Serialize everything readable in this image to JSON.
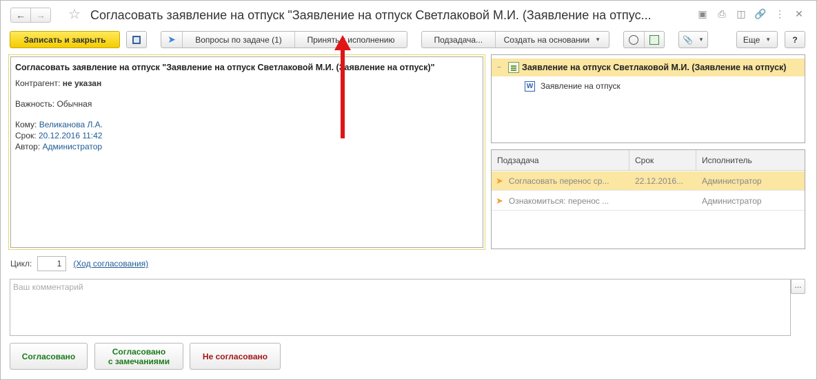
{
  "window": {
    "title": "Согласовать заявление на отпуск \"Заявление на отпуск Светлаковой М.И. (Заявление на отпус..."
  },
  "titlebar": {
    "icons": [
      "back-arrow",
      "forward-arrow",
      "star",
      "save-disk",
      "print",
      "preview",
      "link",
      "more-vertical",
      "close"
    ]
  },
  "toolbar": {
    "save_close_label": "Записать и закрыть",
    "questions_label": "Вопросы по задаче (1)",
    "accept_label": "Принять к исполнению",
    "subtask_label": "Подзадача...",
    "create_based_label": "Создать на основании",
    "more_label": "Еще",
    "help_label": "?"
  },
  "task": {
    "title": "Согласовать заявление на отпуск \"Заявление на отпуск Светлаковой М.И. (Заявление на отпуск)\"",
    "counterparty_label": "Контрагент:",
    "counterparty_value": "не указан",
    "importance_label": "Важность:",
    "importance_value": "Обычная",
    "to_label": "Кому:",
    "to_value": "Великанова Л.А.",
    "due_label": "Срок:",
    "due_value": "20.12.2016 11:42",
    "author_label": "Автор:",
    "author_value": "Администратор"
  },
  "tree": {
    "items": [
      {
        "label": "Заявление на отпуск Светлаковой М.И. (Заявление на отпуск)"
      },
      {
        "label": "Заявление на отпуск"
      }
    ]
  },
  "subtasks": {
    "headers": [
      "Подзадача",
      "Срок",
      "Исполнитель"
    ],
    "rows": [
      {
        "task": "Согласовать перенос ср...",
        "due": "22.12.2016...",
        "executor": "Администратор"
      },
      {
        "task": "Ознакомиться: перенос ...",
        "due": "",
        "executor": "Администратор"
      }
    ]
  },
  "cycle": {
    "label": "Цикл:",
    "value": "1",
    "link": "(Ход согласования)"
  },
  "comment": {
    "placeholder": "Ваш комментарий",
    "ellipsis": "..."
  },
  "actions": {
    "approved": "Согласовано",
    "approved_remarks_1": "Согласовано",
    "approved_remarks_2": "с замечаниями",
    "rejected": "Не согласовано"
  },
  "colors": {
    "primary_button": "#f3cc00",
    "selection": "#fbe6a2",
    "link": "#1f5a96",
    "approve": "#1b7a1b",
    "reject": "#a01818",
    "annotation_arrow": "#e01515"
  }
}
